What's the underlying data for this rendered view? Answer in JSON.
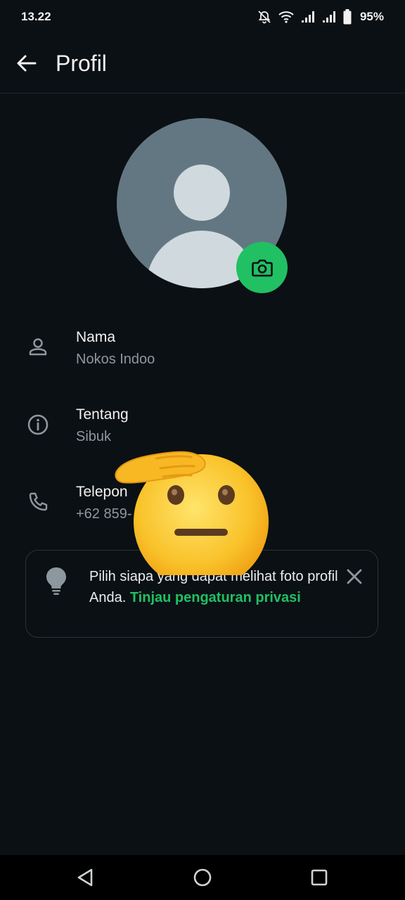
{
  "status_bar": {
    "time": "13.22",
    "battery": "95%"
  },
  "header": {
    "title": "Profil"
  },
  "profile": {
    "name": {
      "label": "Nama",
      "value": "Nokos Indoo"
    },
    "about": {
      "label": "Tentang",
      "value": "Sibuk"
    },
    "phone": {
      "label": "Telepon",
      "value": "+62 859-"
    }
  },
  "banner": {
    "text": "Pilih siapa yang dapat melihat foto profil Anda. ",
    "link": "Tinjau pengaturan privasi"
  },
  "icons": {
    "back": "arrow-left-icon",
    "camera": "camera-icon",
    "person": "person-icon",
    "info": "info-icon",
    "phone": "phone-icon",
    "bulb": "lightbulb-icon",
    "close": "close-icon"
  },
  "colors": {
    "background": "#0b1014",
    "accent": "#21c063",
    "avatar_bg": "#637782",
    "secondary_text": "#8d989e"
  }
}
